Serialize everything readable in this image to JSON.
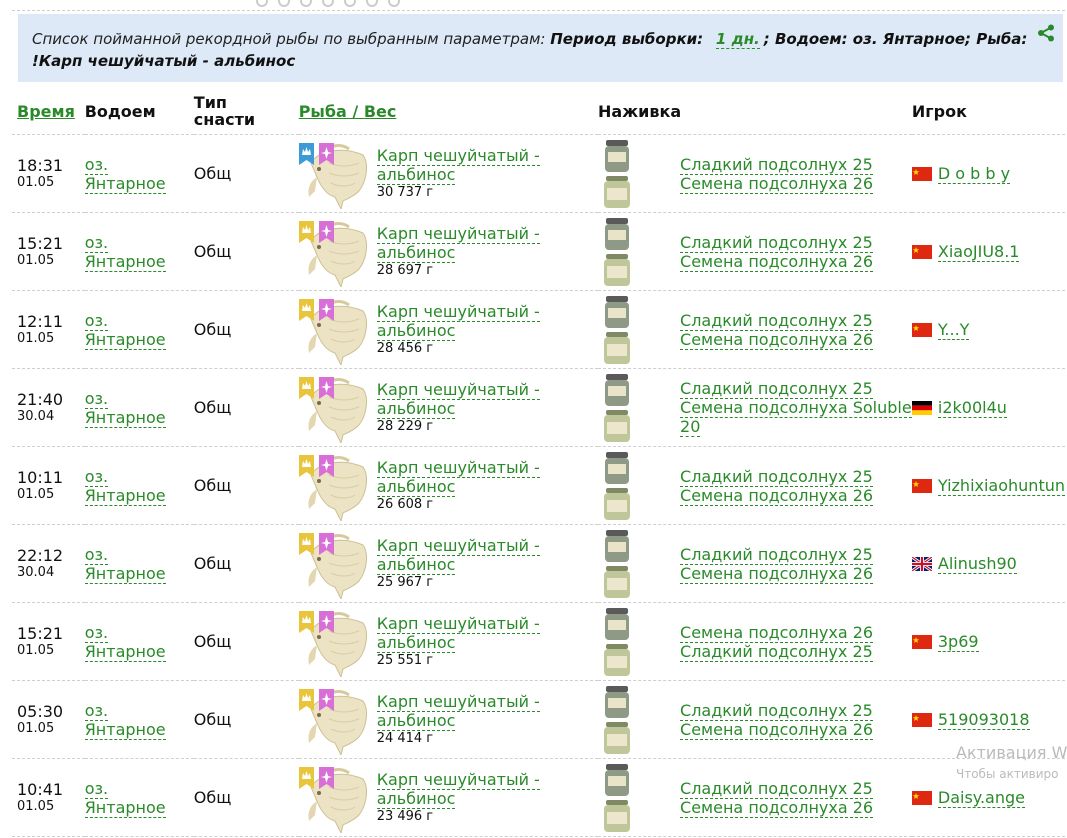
{
  "info": {
    "lead": "Список пойманной рекордной рыбы по выбранным параметрам:",
    "period_label": "Период выборки:",
    "period_value": "1 дн.",
    "rest": "; Водоем: оз. Янтарное; Рыба: !Карп чешуйчатый - альбинос"
  },
  "headers": {
    "time": "Время",
    "lake": "Водоем",
    "tackle": "Тип снасти",
    "fish": "Рыба / Вес",
    "bait": "Наживка",
    "player": "Игрок"
  },
  "rows": [
    {
      "time": "18:31",
      "date": "01.05",
      "lake1": "оз.",
      "lake2": "Янтарное",
      "tackle": "Общ",
      "fish1": "Карп чешуйчатый -",
      "fish2": "альбинос",
      "weight": "30 737 г",
      "bait1": "Сладкий подсолнух 25",
      "bait2": "Семена подсолнуха 26",
      "bait3": "",
      "player": "D o b b y",
      "flag": "cn",
      "badge": "blue"
    },
    {
      "time": "15:21",
      "date": "01.05",
      "lake1": "оз.",
      "lake2": "Янтарное",
      "tackle": "Общ",
      "fish1": "Карп чешуйчатый -",
      "fish2": "альбинос",
      "weight": "28 697 г",
      "bait1": "Сладкий подсолнух 25",
      "bait2": "Семена подсолнуха 26",
      "bait3": "",
      "player": "XiaoJIU8.1",
      "flag": "cn",
      "badge": "gold"
    },
    {
      "time": "12:11",
      "date": "01.05",
      "lake1": "оз.",
      "lake2": "Янтарное",
      "tackle": "Общ",
      "fish1": "Карп чешуйчатый -",
      "fish2": "альбинос",
      "weight": "28 456 г",
      "bait1": "Сладкий подсолнух 25",
      "bait2": "Семена подсолнуха 26",
      "bait3": "",
      "player": "Y...Y",
      "flag": "cn",
      "badge": "gold"
    },
    {
      "time": "21:40",
      "date": "30.04",
      "lake1": "оз.",
      "lake2": "Янтарное",
      "tackle": "Общ",
      "fish1": "Карп чешуйчатый -",
      "fish2": "альбинос",
      "weight": "28 229 г",
      "bait1": "Сладкий подсолнух 25",
      "bait2": "Семена подсолнуха Soluble",
      "bait3": "20",
      "player": "i2k00l4u",
      "flag": "de",
      "badge": "gold"
    },
    {
      "time": "10:11",
      "date": "01.05",
      "lake1": "оз.",
      "lake2": "Янтарное",
      "tackle": "Общ",
      "fish1": "Карп чешуйчатый -",
      "fish2": "альбинос",
      "weight": "26 608 г",
      "bait1": "Сладкий подсолнух 25",
      "bait2": "Семена подсолнуха 26",
      "bait3": "",
      "player": "Yizhixiaohuntun",
      "flag": "cn",
      "badge": "gold"
    },
    {
      "time": "22:12",
      "date": "30.04",
      "lake1": "оз.",
      "lake2": "Янтарное",
      "tackle": "Общ",
      "fish1": "Карп чешуйчатый -",
      "fish2": "альбинос",
      "weight": "25 967 г",
      "bait1": "Сладкий подсолнух 25",
      "bait2": "Семена подсолнуха 26",
      "bait3": "",
      "player": "Alinush90",
      "flag": "gb",
      "badge": "gold"
    },
    {
      "time": "15:21",
      "date": "01.05",
      "lake1": "оз.",
      "lake2": "Янтарное",
      "tackle": "Общ",
      "fish1": "Карп чешуйчатый -",
      "fish2": "альбинос",
      "weight": "25 551 г",
      "bait1": "Семена подсолнуха 26",
      "bait2": "Сладкий подсолнух 25",
      "bait3": "",
      "player": "3p69",
      "flag": "cn",
      "badge": "gold"
    },
    {
      "time": "05:30",
      "date": "01.05",
      "lake1": "оз.",
      "lake2": "Янтарное",
      "tackle": "Общ",
      "fish1": "Карп чешуйчатый -",
      "fish2": "альбинос",
      "weight": "24 414 г",
      "bait1": "Сладкий подсолнух 25",
      "bait2": "Семена подсолнуха 26",
      "bait3": "",
      "player": "519093018",
      "flag": "cn",
      "badge": "gold"
    },
    {
      "time": "10:41",
      "date": "01.05",
      "lake1": "оз.",
      "lake2": "Янтарное",
      "tackle": "Общ",
      "fish1": "Карп чешуйчатый -",
      "fish2": "альбинос",
      "weight": "23 496 г",
      "bait1": "Сладкий подсолнух 25",
      "bait2": "Семена подсолнуха 26",
      "bait3": "",
      "player": "Daisy.ange",
      "flag": "cn",
      "badge": "gold"
    }
  ],
  "watermark": {
    "line1": "Активация W",
    "line2": "Чтобы активиро"
  },
  "colors": {
    "link": "#2a8a2a",
    "info_bg": "#dde9f6",
    "badge_gold": "#e8c53a",
    "badge_blue": "#3c9ad6",
    "badge_pink": "#d86fd6"
  }
}
